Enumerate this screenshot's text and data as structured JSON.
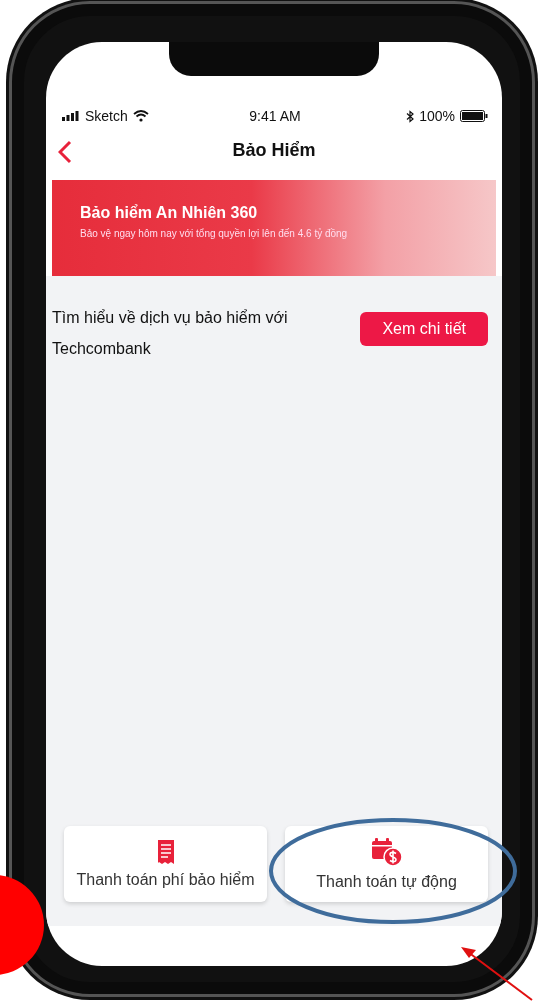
{
  "status_bar": {
    "carrier": "Sketch",
    "time": "9:41 AM",
    "battery": "100%"
  },
  "nav": {
    "title": "Bảo Hiểm"
  },
  "banner": {
    "title": "Bảo hiểm An Nhiên 360",
    "subtitle": "Bảo vệ ngay hôm nay với tổng quyền lợi lên đến 4.6 tỷ đồng"
  },
  "info": {
    "text": "Tìm hiểu về dịch vụ bảo hiểm với Techcombank",
    "button": "Xem chi tiết"
  },
  "actions": [
    {
      "label": "Thanh toán phí bảo hiểm",
      "kind": "receipt"
    },
    {
      "label": "Thanh toán tự động",
      "kind": "calendar"
    }
  ]
}
